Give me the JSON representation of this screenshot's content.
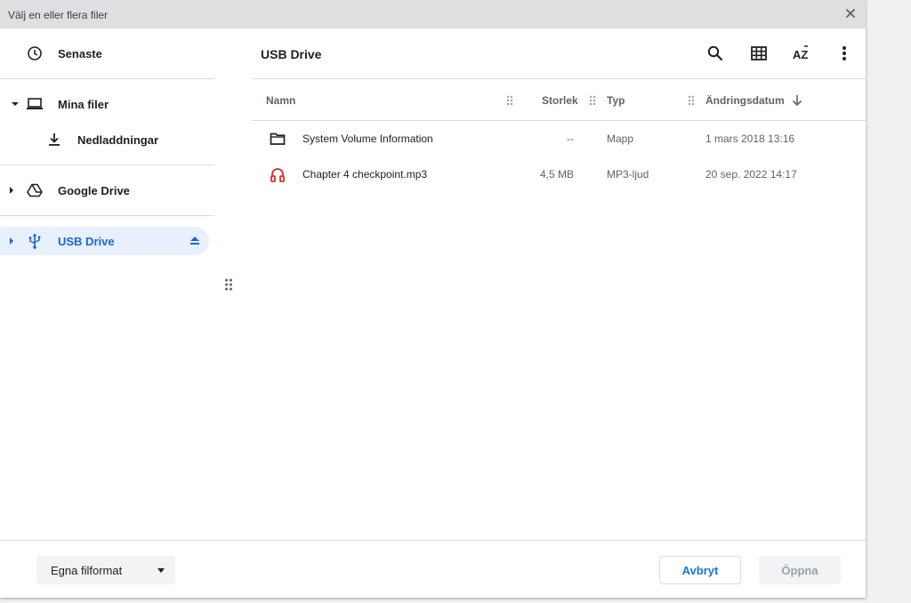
{
  "window": {
    "title": "Välj en eller flera filer"
  },
  "sidebar": {
    "recent": "Senaste",
    "my_files": "Mina filer",
    "downloads": "Nedladdningar",
    "google_drive": "Google Drive",
    "usb_drive": "USB Drive"
  },
  "header": {
    "breadcrumb": "USB Drive"
  },
  "columns": {
    "name": "Namn",
    "size": "Storlek",
    "type": "Typ",
    "modified": "Ändringsdatum"
  },
  "files": [
    {
      "name": "System Volume Information",
      "size": "--",
      "type": "Mapp",
      "modified": "1 mars 2018 13:16",
      "icon": "folder-icon"
    },
    {
      "name": "Chapter 4 checkpoint.mp3",
      "size": "4,5 MB",
      "type": "MP3-ljud",
      "modified": "20 sep. 2022 14:17",
      "icon": "audio-file-icon"
    }
  ],
  "footer": {
    "file_type": "Egna filformat",
    "cancel": "Avbryt",
    "open": "Öppna"
  },
  "colors": {
    "accent": "#1967d2",
    "active_bg": "#e8f0fe",
    "audio_icon": "#d93025"
  }
}
